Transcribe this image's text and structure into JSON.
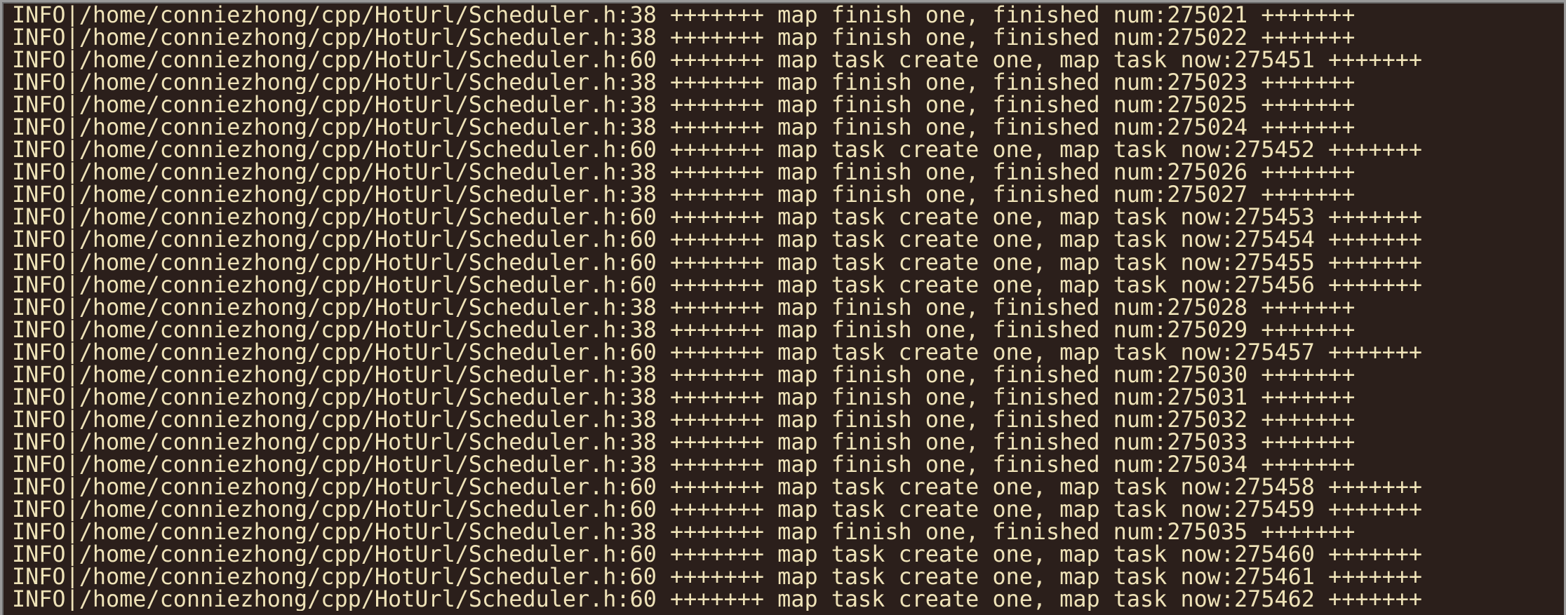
{
  "terminal": {
    "lines": [
      "INFO|/home/conniezhong/cpp/HotUrl/Scheduler.h:38 +++++++ map finish one, finished num:275021 +++++++",
      "INFO|/home/conniezhong/cpp/HotUrl/Scheduler.h:38 +++++++ map finish one, finished num:275022 +++++++",
      "INFO|/home/conniezhong/cpp/HotUrl/Scheduler.h:60 +++++++ map task create one, map task now:275451 +++++++",
      "INFO|/home/conniezhong/cpp/HotUrl/Scheduler.h:38 +++++++ map finish one, finished num:275023 +++++++",
      "INFO|/home/conniezhong/cpp/HotUrl/Scheduler.h:38 +++++++ map finish one, finished num:275025 +++++++",
      "INFO|/home/conniezhong/cpp/HotUrl/Scheduler.h:38 +++++++ map finish one, finished num:275024 +++++++",
      "INFO|/home/conniezhong/cpp/HotUrl/Scheduler.h:60 +++++++ map task create one, map task now:275452 +++++++",
      "INFO|/home/conniezhong/cpp/HotUrl/Scheduler.h:38 +++++++ map finish one, finished num:275026 +++++++",
      "INFO|/home/conniezhong/cpp/HotUrl/Scheduler.h:38 +++++++ map finish one, finished num:275027 +++++++",
      "INFO|/home/conniezhong/cpp/HotUrl/Scheduler.h:60 +++++++ map task create one, map task now:275453 +++++++",
      "INFO|/home/conniezhong/cpp/HotUrl/Scheduler.h:60 +++++++ map task create one, map task now:275454 +++++++",
      "INFO|/home/conniezhong/cpp/HotUrl/Scheduler.h:60 +++++++ map task create one, map task now:275455 +++++++",
      "INFO|/home/conniezhong/cpp/HotUrl/Scheduler.h:60 +++++++ map task create one, map task now:275456 +++++++",
      "INFO|/home/conniezhong/cpp/HotUrl/Scheduler.h:38 +++++++ map finish one, finished num:275028 +++++++",
      "INFO|/home/conniezhong/cpp/HotUrl/Scheduler.h:38 +++++++ map finish one, finished num:275029 +++++++",
      "INFO|/home/conniezhong/cpp/HotUrl/Scheduler.h:60 +++++++ map task create one, map task now:275457 +++++++",
      "INFO|/home/conniezhong/cpp/HotUrl/Scheduler.h:38 +++++++ map finish one, finished num:275030 +++++++",
      "INFO|/home/conniezhong/cpp/HotUrl/Scheduler.h:38 +++++++ map finish one, finished num:275031 +++++++",
      "INFO|/home/conniezhong/cpp/HotUrl/Scheduler.h:38 +++++++ map finish one, finished num:275032 +++++++",
      "INFO|/home/conniezhong/cpp/HotUrl/Scheduler.h:38 +++++++ map finish one, finished num:275033 +++++++",
      "INFO|/home/conniezhong/cpp/HotUrl/Scheduler.h:38 +++++++ map finish one, finished num:275034 +++++++",
      "INFO|/home/conniezhong/cpp/HotUrl/Scheduler.h:60 +++++++ map task create one, map task now:275458 +++++++",
      "INFO|/home/conniezhong/cpp/HotUrl/Scheduler.h:60 +++++++ map task create one, map task now:275459 +++++++",
      "INFO|/home/conniezhong/cpp/HotUrl/Scheduler.h:38 +++++++ map finish one, finished num:275035 +++++++",
      "INFO|/home/conniezhong/cpp/HotUrl/Scheduler.h:60 +++++++ map task create one, map task now:275460 +++++++",
      "INFO|/home/conniezhong/cpp/HotUrl/Scheduler.h:60 +++++++ map task create one, map task now:275461 +++++++",
      "INFO|/home/conniezhong/cpp/HotUrl/Scheduler.h:60 +++++++ map task create one, map task now:275462 +++++++"
    ],
    "colors": {
      "background": "#2b1f1b",
      "text": "#efe3b8"
    }
  }
}
